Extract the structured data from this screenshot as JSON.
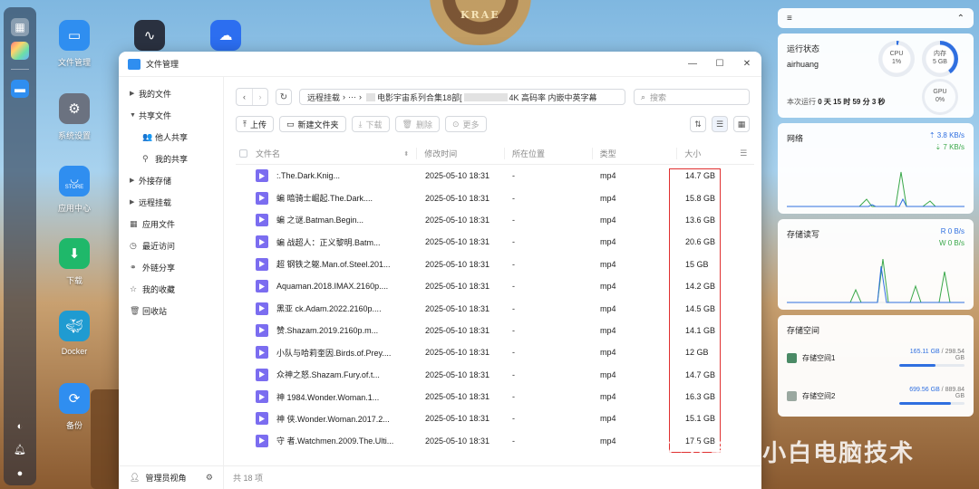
{
  "desktop": {
    "wheel_text": "KRAE",
    "icons": [
      {
        "label": "文件管理",
        "icon": "folder-icon",
        "color": "#2f8ef0"
      },
      {
        "label": "",
        "icon": "monitor-icon",
        "color": "#2a3140"
      },
      {
        "label": "",
        "icon": "cloud-icon",
        "color": "#2c6ef0"
      },
      {
        "label": "系统设置",
        "icon": "gear-icon",
        "color": "#6b7280"
      },
      {
        "label": "应用中心",
        "icon": "store-icon",
        "color": "#2f8ef0"
      },
      {
        "label": "下载",
        "icon": "download-icon",
        "color": "#1fb86a"
      },
      {
        "label": "Docker",
        "icon": "docker-icon",
        "color": "#1f9bd1"
      },
      {
        "label": "备份",
        "icon": "backup-icon",
        "color": "#2f8ef0"
      }
    ],
    "store_badge": "STORE"
  },
  "window": {
    "title": "文件管理",
    "controls": [
      "—",
      "☐",
      "✕"
    ]
  },
  "sidebar": {
    "items": [
      {
        "label": "我的文件",
        "prefix": "▶",
        "level": 0
      },
      {
        "label": "共享文件",
        "prefix": "▼",
        "level": 0
      },
      {
        "label": "他人共享",
        "prefix": "👥",
        "level": 1
      },
      {
        "label": "我的共享",
        "prefix": "⚲",
        "level": 1
      },
      {
        "label": "外接存储",
        "prefix": "▶",
        "level": 0
      },
      {
        "label": "远程挂载",
        "prefix": "▶",
        "level": 0
      },
      {
        "label": "应用文件",
        "prefix": "▦",
        "level": 0
      },
      {
        "label": "最近访问",
        "prefix": "◷",
        "level": 0
      },
      {
        "label": "外链分享",
        "prefix": "⚭",
        "level": 0
      },
      {
        "label": "我的收藏",
        "prefix": "☆",
        "level": 0
      },
      {
        "label": "回收站",
        "prefix": "🗑",
        "level": 0
      }
    ],
    "footer_label": "管理员视角"
  },
  "nav": {
    "back": "‹",
    "forward": "›",
    "refresh": "↻",
    "breadcrumb_root": "远程挂载",
    "breadcrumb_sep": "›",
    "breadcrumb_ellipsis": "···",
    "breadcrumb_part1": "电影宇宙系列合集18部[",
    "breadcrumb_part2": "4K 高码率 内嵌中英字幕",
    "search_placeholder": "搜索"
  },
  "toolbar": {
    "upload": "上传",
    "new_folder": "新建文件夹",
    "download": "下载",
    "delete": "删除",
    "more": "更多"
  },
  "table": {
    "headers": {
      "name": "文件名",
      "time": "修改时间",
      "location": "所在位置",
      "type": "类型",
      "size": "大小"
    },
    "rows": [
      {
        "name": ":.The.Dark.Knig...",
        "time": "2025-05-10 18:31",
        "location": "-",
        "type": "mp4",
        "size": "14.7 GB"
      },
      {
        "name": "蝙 暗骑士崛起.The.Dark....",
        "time": "2025-05-10 18:31",
        "location": "-",
        "type": "mp4",
        "size": "15.8 GB"
      },
      {
        "name": "蝙 之谜.Batman.Begin...",
        "time": "2025-05-10 18:31",
        "location": "-",
        "type": "mp4",
        "size": "13.6 GB"
      },
      {
        "name": "蝙 战超人：正义黎明.Batm...",
        "time": "2025-05-10 18:31",
        "location": "-",
        "type": "mp4",
        "size": "20.6 GB"
      },
      {
        "name": "超 钢铁之躯.Man.of.Steel.201...",
        "time": "2025-05-10 18:31",
        "location": "-",
        "type": "mp4",
        "size": "15 GB"
      },
      {
        "name": "Aquaman.2018.IMAX.2160p....",
        "time": "2025-05-10 18:31",
        "location": "-",
        "type": "mp4",
        "size": "14.2 GB"
      },
      {
        "name": "黑亚 ck.Adam.2022.2160p....",
        "time": "2025-05-10 18:31",
        "location": "-",
        "type": "mp4",
        "size": "14.5 GB"
      },
      {
        "name": "赞.Shazam.2019.2160p.m...",
        "time": "2025-05-10 18:31",
        "location": "-",
        "type": "mp4",
        "size": "14.1 GB"
      },
      {
        "name": "小队与哈莉奎因.Birds.of.Prey....",
        "time": "2025-05-10 18:31",
        "location": "-",
        "type": "mp4",
        "size": "12 GB"
      },
      {
        "name": "众神之怒.Shazam.Fury.of.t...",
        "time": "2025-05-10 18:31",
        "location": "-",
        "type": "mp4",
        "size": "14.7 GB"
      },
      {
        "name": "神 1984.Wonder.Woman.1...",
        "time": "2025-05-10 18:31",
        "location": "-",
        "type": "mp4",
        "size": "16.3 GB"
      },
      {
        "name": "神 侠.Wonder.Woman.2017.2...",
        "time": "2025-05-10 18:31",
        "location": "-",
        "type": "mp4",
        "size": "15.1 GB"
      },
      {
        "name": "守 者.Watchmen.2009.The.Ulti...",
        "time": "2025-05-10 18:31",
        "location": "-",
        "type": "mp4",
        "size": "17.5 GB"
      }
    ],
    "status": "共 18 项"
  },
  "panel": {
    "header_left": "≡",
    "header_right": "⌃",
    "sys": {
      "title": "运行状态",
      "host": "airhuang",
      "cpu_label": "CPU",
      "cpu_value": "1%",
      "cpu_fraction": 0.01,
      "mem_label": "内存",
      "mem_value": "5 GB",
      "mem_fraction": 0.4,
      "gpu_label": "GPU",
      "gpu_value": "0%",
      "runtime_label": "本次运行",
      "runtime_value": "0 天 15 时 59 分 3 秒"
    },
    "net": {
      "title": "网络",
      "up": "3.8 KB/s",
      "down": "7 KB/s"
    },
    "io": {
      "title": "存储读写",
      "read": "R 0 B/s",
      "write": "W 0 B/s"
    },
    "storage": {
      "title": "存储空间",
      "items": [
        {
          "name": "存储空间1",
          "used": "165.11 GB",
          "total": "298.54 GB",
          "fraction": 0.553
        },
        {
          "name": "存储空间2",
          "used": "699.56 GB",
          "total": "889.84 GB",
          "fraction": 0.786
        }
      ]
    }
  },
  "watermark": {
    "text": "公众号 · 小白电脑技术"
  },
  "colors": {
    "accent": "#2f8ef0",
    "video_icon": "#7b6df0",
    "highlight": "#e03030",
    "net_up": "#2f6fe0",
    "net_down": "#3aa84a"
  }
}
